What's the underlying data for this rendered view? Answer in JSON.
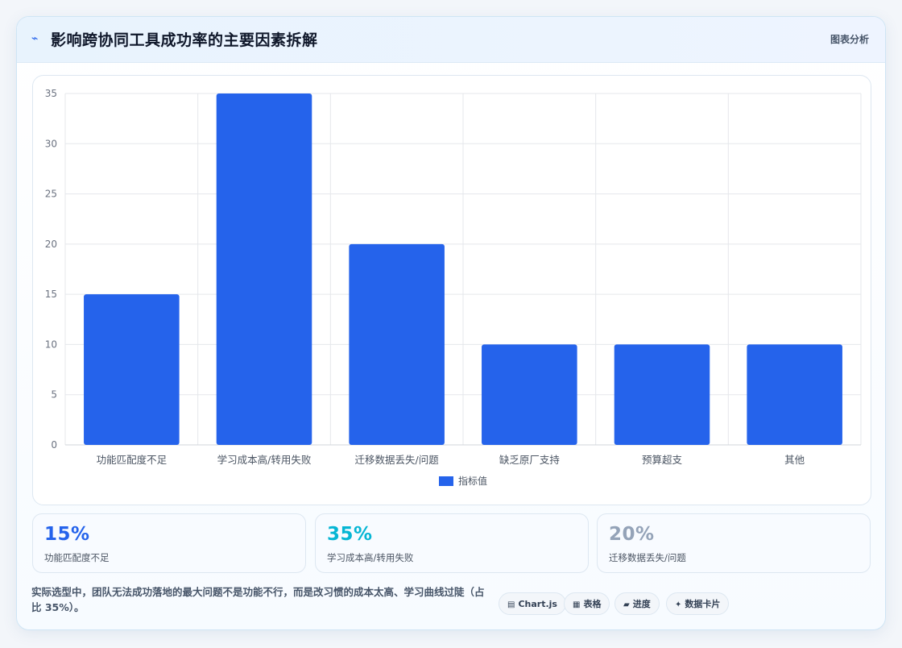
{
  "header": {
    "title": "影响跨协同工具成功率的主要因素拆解",
    "action_label": "图表分析"
  },
  "chart_data": {
    "type": "bar",
    "categories": [
      "功能匹配度不足",
      "学习成本高/转用失败",
      "迁移数据丢失/问题",
      "缺乏原厂支持",
      "预算超支",
      "其他"
    ],
    "series": [
      {
        "name": "指标值",
        "values": [
          15,
          35,
          20,
          10,
          10,
          10
        ]
      }
    ],
    "ylim": [
      0,
      35
    ],
    "yticks": [
      0,
      5,
      10,
      15,
      20,
      25,
      30,
      35
    ],
    "grid": true,
    "legend": "bottom-center",
    "bar_color": "#2563eb"
  },
  "stats": [
    {
      "value": "15%",
      "label": "功能匹配度不足",
      "color": "#2563eb"
    },
    {
      "value": "35%",
      "label": "学习成本高/转用失败",
      "color": "#06b6d4"
    },
    {
      "value": "20%",
      "label": "迁移数据丢失/问题",
      "color": "#94a3b8"
    }
  ],
  "footer": {
    "summary": "实际选型中，团队无法成功落地的最大问题不是功能不行，而是改习惯的成本太高、学习曲线过陡（占比 35%）。"
  },
  "chips": [
    {
      "icon": "▤",
      "label": "Chart.js"
    },
    {
      "icon": "▦",
      "label": "表格"
    },
    {
      "icon": "▰",
      "label": "进度"
    },
    {
      "icon": "✦",
      "label": "数据卡片"
    }
  ]
}
